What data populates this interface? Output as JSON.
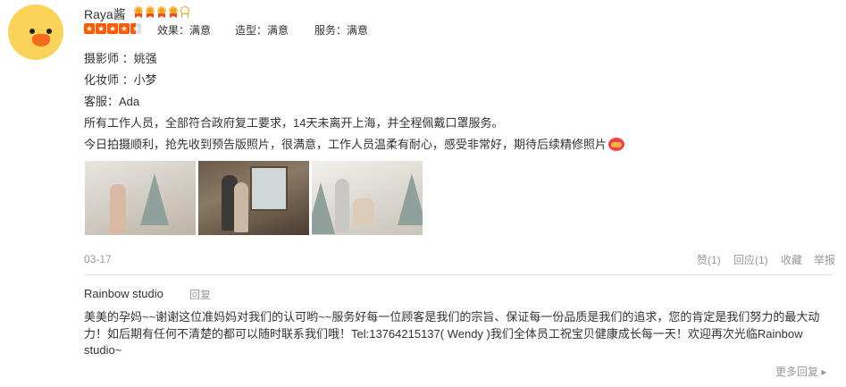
{
  "review": {
    "username": "Raya酱",
    "member_level": 4,
    "member_level_max": 5,
    "star_rating": 4.5,
    "ratings": [
      {
        "label": "效果：满意"
      },
      {
        "label": "造型：满意"
      },
      {
        "label": "服务：满意"
      }
    ],
    "lines": [
      "摄影师 ：姚强",
      "化妆师 ：小梦",
      "客服：Ada",
      "所有工作人员，全部符合政府复工要求，14天未离开上海，并全程佩戴口罩服务。",
      "今日拍摄顺利，抢先收到预告版照片，很满意，工作人员温柔有耐心，感受非常好，期待后续精修照片"
    ],
    "date": "03-17",
    "actions": {
      "like": "赞(1)",
      "reply": "回应(1)",
      "favorite": "收藏",
      "report": "举报"
    }
  },
  "shop_reply": {
    "shop_name": "Rainbow studio",
    "reply_label": "回复",
    "text": "美美的孕妈~~谢谢这位准妈妈对我们的认可哟~~服务好每一位顾客是我们的宗旨、保证每一份品质是我们的追求，您的肯定是我们努力的最大动力！如后期有任何不清楚的都可以随时联系我们哦！Tel:13764215137( Wendy )我们全体员工祝宝贝健康成长每一天！欢迎再次光临Rainbow studio~"
  },
  "more_replies": "更多回复 ▸"
}
